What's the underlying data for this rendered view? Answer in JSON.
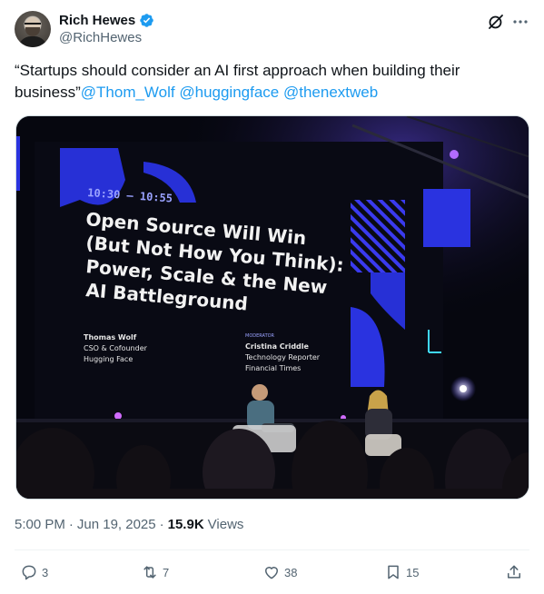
{
  "author": {
    "display_name": "Rich Hewes",
    "handle": "@RichHewes",
    "verified": true,
    "verified_color": "#1d9bf0"
  },
  "header_icons": {
    "grok": "grok-icon",
    "more": "more-icon"
  },
  "tweet": {
    "text": "“Startups should consider an AI first approach when building their business”",
    "mentions": [
      "@Thom_Wolf",
      "@huggingface",
      "@thenextweb"
    ]
  },
  "media": {
    "slide": {
      "time": "10:30 – 10:55",
      "title_lines": [
        "Open Source Will Win",
        "(But Not How You Think):",
        "Power, Scale & the New",
        "AI Battleground"
      ],
      "speaker": {
        "name": "Thomas Wolf",
        "title_lines": [
          "CSO & Cofounder",
          "Hugging Face"
        ]
      },
      "moderator_label": "MODERATOR",
      "moderator": {
        "name": "Cristina Criddle",
        "title_lines": [
          "Technology Reporter",
          "Financial Times"
        ]
      }
    },
    "accent_color": "#1f2bd1"
  },
  "meta": {
    "time": "5:00 PM",
    "separator": "·",
    "date": "Jun 19, 2025",
    "views_count": "15.9K",
    "views_label": "Views"
  },
  "actions": {
    "replies": "3",
    "reposts": "7",
    "likes": "38",
    "bookmarks": "15"
  },
  "colors": {
    "text": "#0f1419",
    "secondary": "#536471",
    "link": "#1d9bf0",
    "divider": "#eff3f4"
  }
}
